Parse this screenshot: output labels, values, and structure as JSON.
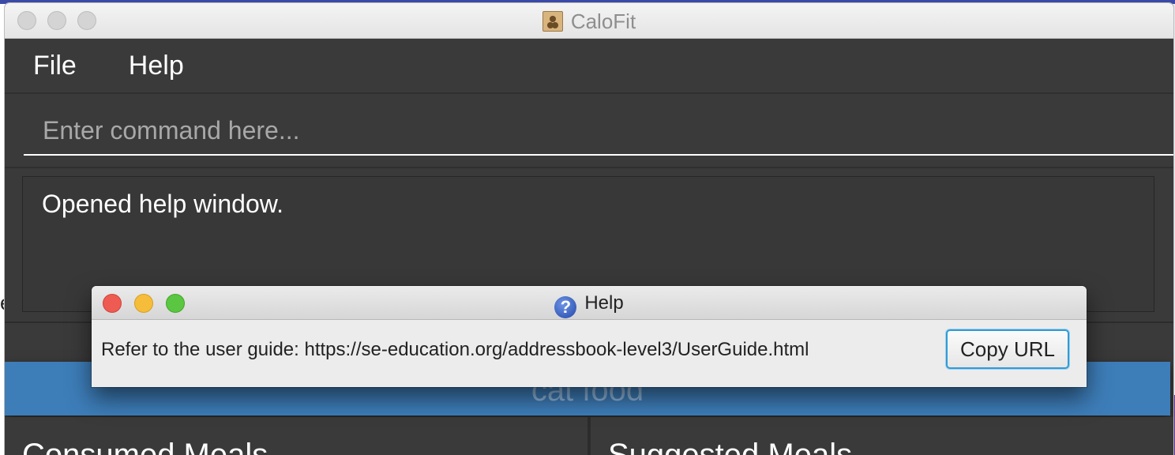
{
  "window": {
    "title": "CaloFit"
  },
  "menu": {
    "items": [
      "File",
      "Help"
    ]
  },
  "command": {
    "placeholder": "Enter command here..."
  },
  "result": {
    "text": "Opened help window."
  },
  "calorie_bar": {
    "text": "cat food"
  },
  "panels": {
    "left_title": "Consumed Meals",
    "right_title": "Suggested Meals"
  },
  "help_dialog": {
    "title": "Help",
    "message": "Refer to the user guide: https://se-education.org/addressbook-level3/UserGuide.html",
    "copy_button": "Copy URL"
  },
  "background": {
    "left_fragment": "e"
  },
  "colors": {
    "window_bg": "#3a3a3a",
    "calorie_bar": "#3d7db8",
    "close": "#ee5b52",
    "minimize": "#f6bd3a",
    "maximize": "#5bc641",
    "focus_ring": "#2f9bd6"
  },
  "icons": {
    "app": "contacts-app-icon",
    "help": "question-mark-icon"
  }
}
